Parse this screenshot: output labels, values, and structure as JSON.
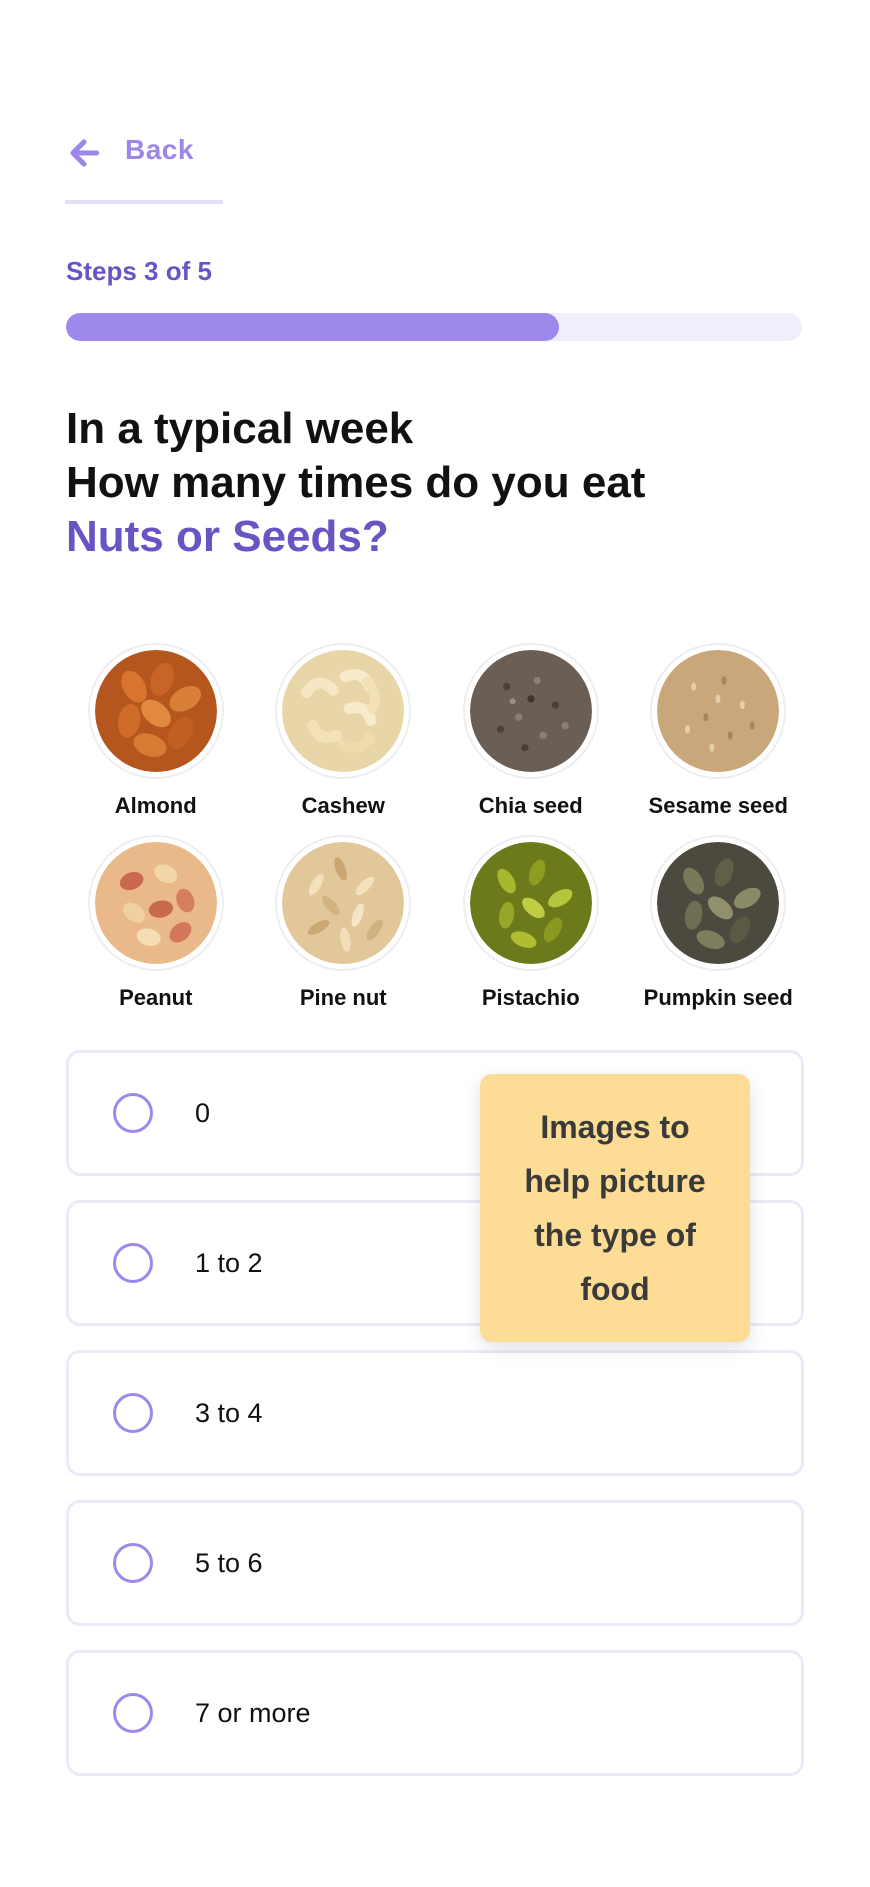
{
  "header": {
    "back_label": "Back",
    "back_icon": "arrow-left-icon",
    "steps_label": "Steps 3 of 5",
    "progress": {
      "current": 3,
      "total": 5,
      "fraction": 0.67
    }
  },
  "question": {
    "line1": "In a typical week",
    "line2": "How many times do you eat",
    "highlight": "Nuts or Seeds?"
  },
  "foods": [
    {
      "name": "Almond"
    },
    {
      "name": "Cashew"
    },
    {
      "name": "Chia seed"
    },
    {
      "name": "Sesame seed"
    },
    {
      "name": "Peanut"
    },
    {
      "name": "Pine nut"
    },
    {
      "name": "Pistachio"
    },
    {
      "name": "Pumpkin seed"
    }
  ],
  "options": [
    {
      "label": "0"
    },
    {
      "label": "1 to 2"
    },
    {
      "label": "3 to 4"
    },
    {
      "label": "5 to 6"
    },
    {
      "label": "7 or more"
    }
  ],
  "callout": {
    "text": "Images to help picture the type of food"
  },
  "colors": {
    "accent": "#9f88ec",
    "accent_dark": "#6a54c4",
    "progress_track": "#f1eefb",
    "callout_bg": "#fddc95"
  }
}
